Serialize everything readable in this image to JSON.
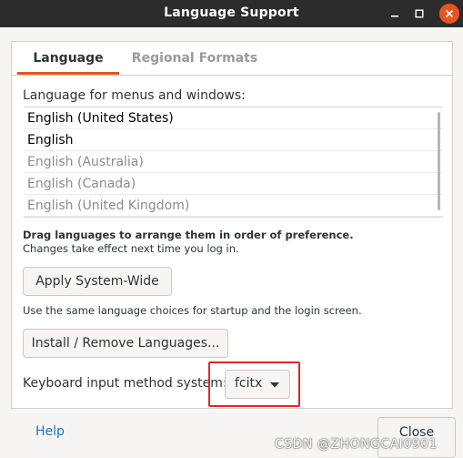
{
  "window": {
    "title": "Language Support",
    "controls": [
      "minimize-icon",
      "maximize-icon",
      "close-icon"
    ],
    "accent_color": "#e95420"
  },
  "tabs": [
    {
      "label": "Language",
      "active": true
    },
    {
      "label": "Regional Formats",
      "active": false
    }
  ],
  "language_section": {
    "label": "Language for menus and windows:",
    "items": [
      {
        "label": "English (United States)",
        "enabled": true
      },
      {
        "label": "English",
        "enabled": true
      },
      {
        "label": "English (Australia)",
        "enabled": false
      },
      {
        "label": "English (Canada)",
        "enabled": false
      },
      {
        "label": "English (United Kingdom)",
        "enabled": false
      }
    ],
    "drag_note": "Drag languages to arrange them in order of preference.",
    "change_note": "Changes take effect next time you log in."
  },
  "apply_button": "Apply System-Wide",
  "apply_note": "Use the same language choices for startup and the login screen.",
  "install_button": "Install / Remove Languages...",
  "keyboard": {
    "label": "Keyboard input method system:",
    "selected": "fcitx",
    "highlight_color": "#e0262a"
  },
  "footer": {
    "help_label": "Help",
    "close_label": "Close"
  },
  "watermark": "CSDN @ZHONGCAI0901"
}
